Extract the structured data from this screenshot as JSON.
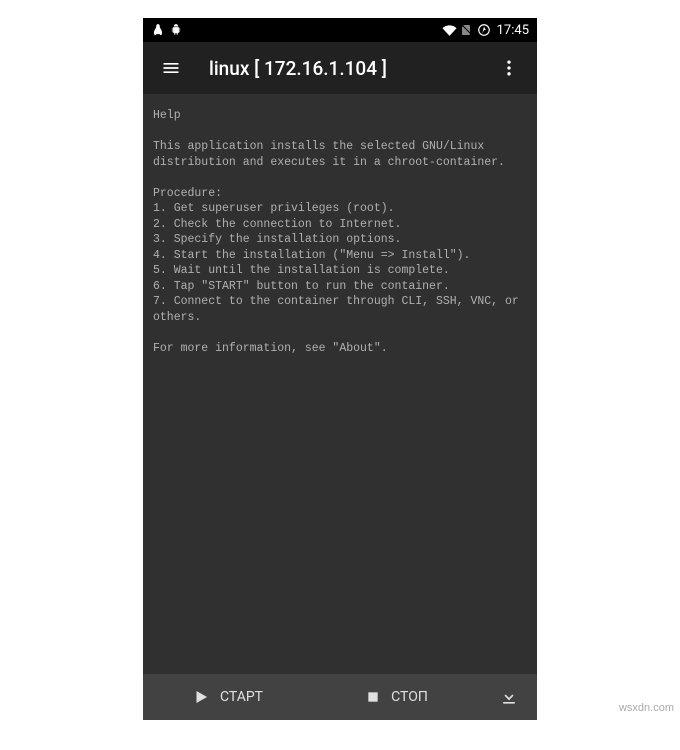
{
  "status": {
    "time": "17:45"
  },
  "appbar": {
    "title": "linux  [ 172.16.1.104 ]"
  },
  "help": {
    "heading": "Help",
    "intro": "This application installs the selected GNU/Linux distribution and executes it in a chroot-container.",
    "procedure_label": "Procedure:",
    "steps": [
      "1. Get superuser privileges (root).",
      "2. Check the connection to Internet.",
      "3. Specify the installation options.",
      "4. Start the installation (\"Menu => Install\").",
      "5. Wait until the installation is complete.",
      "6. Tap \"START\" button to run the container.",
      "7. Connect to the container through CLI, SSH, VNC, or others."
    ],
    "footer": "For more information, see \"About\"."
  },
  "bottom": {
    "start": "СТАРТ",
    "stop": "СТОП"
  },
  "watermark": "wsxdn.com"
}
